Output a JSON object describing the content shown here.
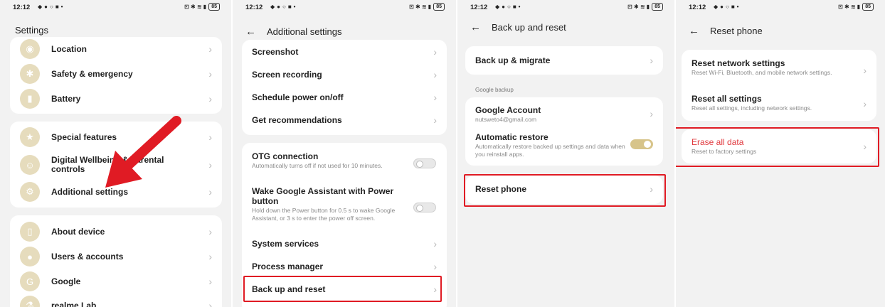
{
  "statusbar": {
    "time": "12:12",
    "battery": "85"
  },
  "screen1": {
    "title": "Settings",
    "items": [
      {
        "label": "Location"
      },
      {
        "label": "Safety & emergency"
      },
      {
        "label": "Battery"
      },
      {
        "label": "Special features"
      },
      {
        "label": "Digital Wellbeing & parental controls"
      },
      {
        "label": "Additional settings"
      },
      {
        "label": "About device"
      },
      {
        "label": "Users & accounts"
      },
      {
        "label": "Google"
      },
      {
        "label": "realme Lab"
      }
    ]
  },
  "screen2": {
    "title": "Additional settings",
    "items": [
      {
        "label": "Screenshot"
      },
      {
        "label": "Screen recording"
      },
      {
        "label": "Schedule power on/off"
      },
      {
        "label": "Get recommendations"
      },
      {
        "label": "OTG connection",
        "sub": "Automatically turns off if not used for 10 minutes."
      },
      {
        "label": "Wake Google Assistant with Power button",
        "sub": "Hold down the Power button for 0.5 s to wake Google Assistant, or 3 s to enter the power off screen."
      },
      {
        "label": "System services"
      },
      {
        "label": "Process manager"
      },
      {
        "label": "Back up and reset"
      }
    ]
  },
  "screen3": {
    "title": "Back up and reset",
    "backup_migrate": "Back up & migrate",
    "section": "Google backup",
    "google_account": "Google Account",
    "account_email": "nutsweto4@gmail.com",
    "auto_restore": "Automatic restore",
    "auto_restore_sub": "Automatically restore backed up settings and data when you reinstall apps.",
    "reset_phone": "Reset phone"
  },
  "screen4": {
    "title": "Reset phone",
    "network": "Reset network settings",
    "network_sub": "Reset Wi-Fi, Bluetooth, and mobile network settings.",
    "all_settings": "Reset all settings",
    "all_settings_sub": "Reset all settings, including network settings.",
    "erase": "Erase all data",
    "erase_sub": "Reset to factory settings"
  },
  "colors": {
    "highlight": "#e01b24",
    "accent": "#d7c48a",
    "erase": "#e0393e"
  }
}
